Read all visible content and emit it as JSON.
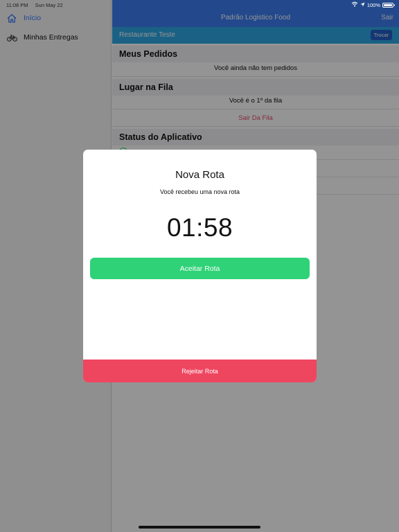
{
  "status_bar": {
    "time": "11:08 PM",
    "date": "Sun May 22",
    "battery": "100%"
  },
  "sidebar": {
    "items": [
      {
        "label": "Início",
        "icon": "home-icon",
        "active": true
      },
      {
        "label": "Minhas Entregas",
        "icon": "bicycle-icon",
        "active": false
      }
    ]
  },
  "navbar": {
    "title": "Padrão Logistico Food",
    "right_button": "Sair"
  },
  "restaurant": {
    "name": "Restaurante Teste",
    "change_button": "Trocar"
  },
  "sections": {
    "orders": {
      "title": "Meus Pedidos",
      "empty_text": "Você ainda não tem pedidos"
    },
    "queue": {
      "title": "Lugar na Fila",
      "position_text": "Você é o 1º da fila",
      "leave_button": "Sair Da Fila"
    },
    "app_status": {
      "title": "Status do Aplicativo"
    }
  },
  "modal": {
    "title": "Nova Rota",
    "subtitle": "Você recebeu uma nova rota",
    "timer": "01:58",
    "accept_button": "Aceitar Rota",
    "reject_button": "Rejeitar Rota"
  },
  "colors": {
    "navbar": "#3d7ff2",
    "restaurant_bar": "#2ea8e6",
    "accept": "#2fd277",
    "reject": "#ef4660",
    "active_link": "#3478f6"
  }
}
